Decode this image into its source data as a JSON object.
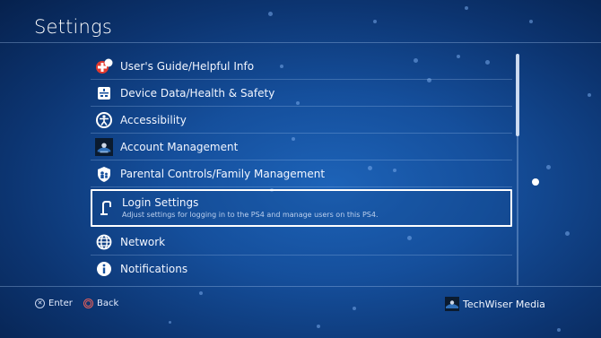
{
  "header": {
    "title": "Settings"
  },
  "menu": {
    "items": [
      {
        "label": "User's Guide/Helpful Info",
        "icon": "guide-icon"
      },
      {
        "label": "Device Data/Health & Safety",
        "icon": "device-data-icon"
      },
      {
        "label": "Accessibility",
        "icon": "accessibility-icon"
      },
      {
        "label": "Account Management",
        "icon": "account-avatar-icon"
      },
      {
        "label": "Parental Controls/Family Management",
        "icon": "parental-controls-icon"
      },
      {
        "label": "Login Settings",
        "description": "Adjust settings for logging in to the PS4 and manage users on this PS4.",
        "icon": "login-icon",
        "selected": true
      },
      {
        "label": "Network",
        "icon": "globe-icon"
      },
      {
        "label": "Notifications",
        "icon": "info-icon"
      }
    ]
  },
  "footer": {
    "enter_label": "Enter",
    "back_label": "Back",
    "user_name": "TechWiser Media"
  },
  "colors": {
    "selection_border": "#ffffff",
    "background": "#154f9c"
  }
}
